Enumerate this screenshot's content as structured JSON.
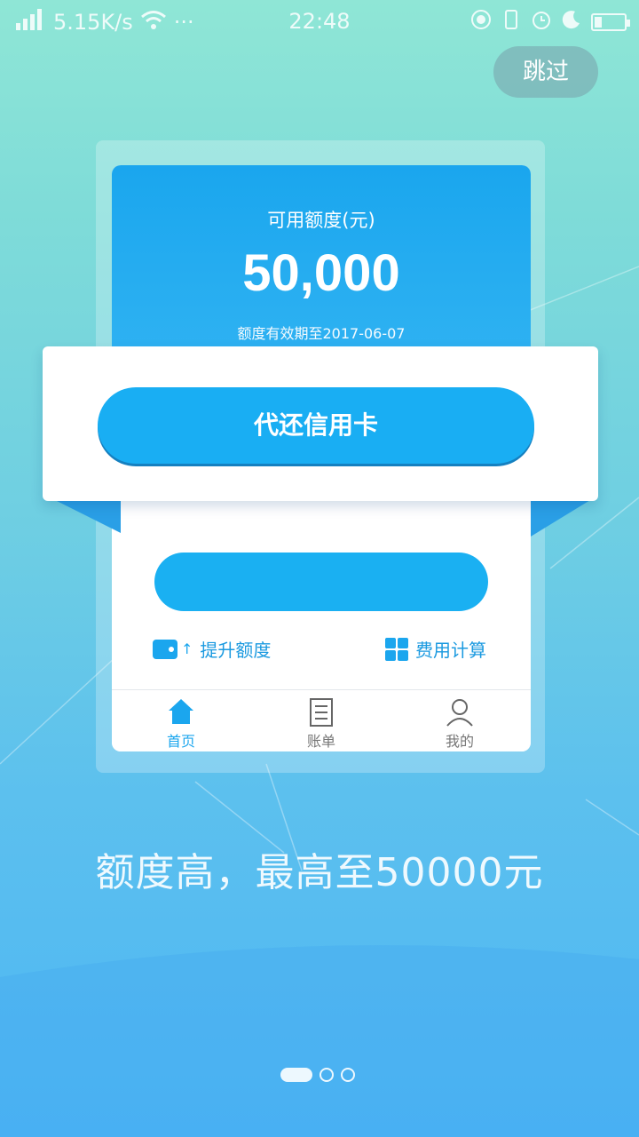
{
  "status_bar": {
    "network_speed": "5.15K/s",
    "more": "···",
    "time": "22:48"
  },
  "skip_label": "跳过",
  "card": {
    "credit_label": "可用额度(元)",
    "credit_amount": "50,000",
    "expiry": "额度有效期至2017-06-07",
    "shortcut_left": "提升额度",
    "shortcut_right": "费用计算",
    "tabs": [
      {
        "label": "首页",
        "icon": "home-icon"
      },
      {
        "label": "账单",
        "icon": "bill-icon"
      },
      {
        "label": "我的",
        "icon": "user-icon"
      }
    ]
  },
  "popup": {
    "button_label": "代还信用卡"
  },
  "slogan": "额度高，最高至50000元",
  "pagination": {
    "current": 1,
    "total": 3
  },
  "colors": {
    "accent": "#19aef3",
    "card_header": "#1aa6ee"
  }
}
